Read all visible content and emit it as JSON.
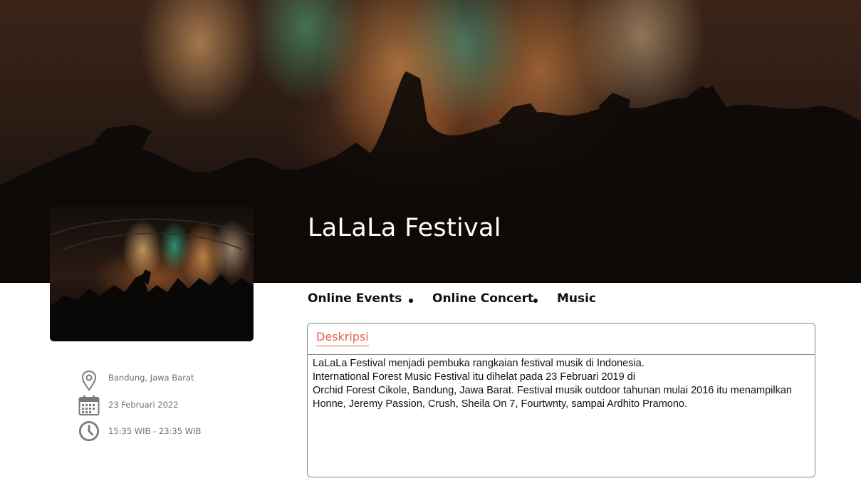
{
  "event": {
    "title": "LaLaLa Festival"
  },
  "info": {
    "location": "Bandung, Jawa Barat",
    "date": "23 Februari 2022",
    "time": "15:35 WIB - 23:35 WIB",
    "icons": [
      "location-pin-icon",
      "calendar-icon",
      "clock-icon"
    ]
  },
  "tags": [
    "Online Events",
    "Online Concert",
    "Music"
  ],
  "description": {
    "heading": "Deskripsi",
    "lines": [
      "LaLaLa Festival menjadi pembuka rangkaian festival musik di Indonesia.",
      "International Forest Music Festival itu dihelat pada 23 Februari 2019 di",
      "Orchid Forest Cikole, Bandung, Jawa Barat. Festival musik outdoor tahunan mulai 2016 itu menampilkan",
      "Honne, Jeremy Passion, Crush, Sheila On 7, Fourtwnty, sampai Ardhito Pramono."
    ]
  },
  "colors": {
    "accent": "#e0654f",
    "border": "#8a8a8a",
    "muted_text": "#6e6e6e",
    "icon": "#7a7a7a"
  }
}
